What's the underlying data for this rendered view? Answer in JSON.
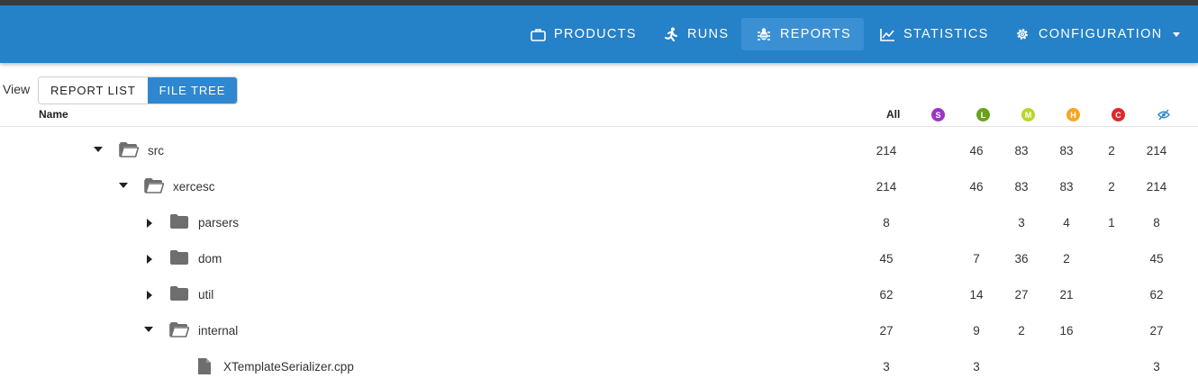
{
  "nav": {
    "items": [
      {
        "label": "PRODUCTS",
        "icon": "briefcase-icon"
      },
      {
        "label": "RUNS",
        "icon": "running-person-icon"
      },
      {
        "label": "REPORTS",
        "icon": "bug-icon",
        "active": true
      },
      {
        "label": "STATISTICS",
        "icon": "line-chart-icon"
      },
      {
        "label": "CONFIGURATION",
        "icon": "gear-icon",
        "has_dropdown": true
      }
    ]
  },
  "view": {
    "label": "View",
    "options": [
      "REPORT LIST",
      "FILE TREE"
    ],
    "selected": "FILE TREE"
  },
  "table": {
    "headers": {
      "name": "Name",
      "all": "All",
      "severities": [
        {
          "letter": "S",
          "meaning": "style",
          "color": "#9b35c7"
        },
        {
          "letter": "L",
          "meaning": "low",
          "color": "#6aa11d"
        },
        {
          "letter": "M",
          "meaning": "medium",
          "color": "#b8d62b"
        },
        {
          "letter": "H",
          "meaning": "high",
          "color": "#f5a623"
        },
        {
          "letter": "C",
          "meaning": "critical",
          "color": "#e0262c"
        },
        {
          "letter": "",
          "meaning": "suppressed",
          "icon": "eye-off-icon",
          "color": "#2f87cf"
        }
      ]
    },
    "rows": [
      {
        "name": "src",
        "type": "folder",
        "expanded": true,
        "depth": 0,
        "all": "214",
        "s": "",
        "l": "46",
        "m": "83",
        "h": "83",
        "c": "2",
        "unreviewed": "214"
      },
      {
        "name": "xercesc",
        "type": "folder",
        "expanded": true,
        "depth": 1,
        "all": "214",
        "s": "",
        "l": "46",
        "m": "83",
        "h": "83",
        "c": "2",
        "unreviewed": "214"
      },
      {
        "name": "parsers",
        "type": "folder",
        "expanded": false,
        "depth": 2,
        "all": "8",
        "s": "",
        "l": "",
        "m": "3",
        "h": "4",
        "c": "1",
        "unreviewed": "8"
      },
      {
        "name": "dom",
        "type": "folder",
        "expanded": false,
        "depth": 2,
        "all": "45",
        "s": "",
        "l": "7",
        "m": "36",
        "h": "2",
        "c": "",
        "unreviewed": "45"
      },
      {
        "name": "util",
        "type": "folder",
        "expanded": false,
        "depth": 2,
        "all": "62",
        "s": "",
        "l": "14",
        "m": "27",
        "h": "21",
        "c": "",
        "unreviewed": "62"
      },
      {
        "name": "internal",
        "type": "folder",
        "expanded": true,
        "depth": 2,
        "all": "27",
        "s": "",
        "l": "9",
        "m": "2",
        "h": "16",
        "c": "",
        "unreviewed": "27"
      },
      {
        "name": "XTemplateSerializer.cpp",
        "type": "file",
        "expanded": false,
        "depth": 3,
        "all": "3",
        "s": "",
        "l": "3",
        "m": "",
        "h": "",
        "c": "",
        "unreviewed": "3"
      }
    ]
  }
}
